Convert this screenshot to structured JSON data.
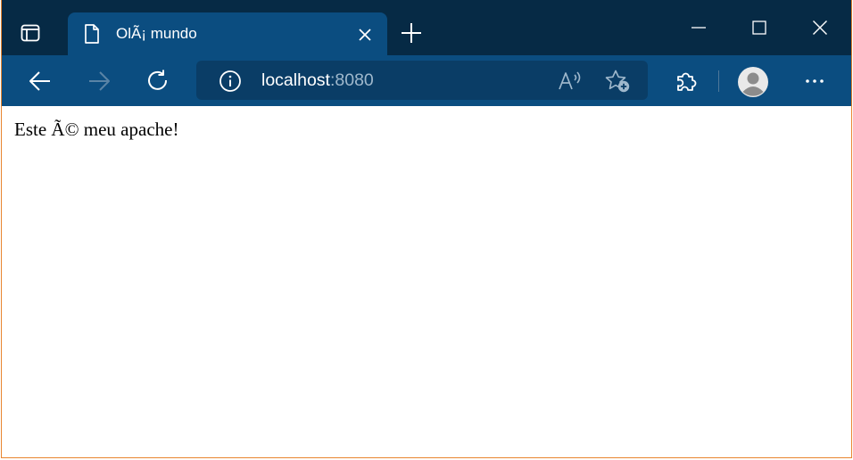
{
  "browser": {
    "tab": {
      "title": "OlÃ¡ mundo"
    },
    "address": {
      "host": "localhost",
      "port": ":8080"
    },
    "icons": {
      "tab_actions": "tab-actions-icon",
      "favicon": "document-icon",
      "tab_close": "close-icon",
      "new_tab": "plus-icon",
      "minimize": "minimize-icon",
      "maximize": "maximize-icon",
      "close_window": "close-icon",
      "back": "arrow-left-icon",
      "forward": "arrow-right-icon",
      "refresh": "refresh-icon",
      "site_info": "info-icon",
      "read_aloud": "read-aloud-icon",
      "favorite_add": "star-plus-icon",
      "extensions": "puzzle-icon",
      "profile": "avatar-icon",
      "more": "more-icon"
    },
    "colors": {
      "titlebar": "#062a45",
      "toolbar": "#0b4d80",
      "addressbar": "#0a3d66",
      "window_border": "#e8852f"
    }
  },
  "page": {
    "body_text": "Este Ã© meu apache!"
  }
}
